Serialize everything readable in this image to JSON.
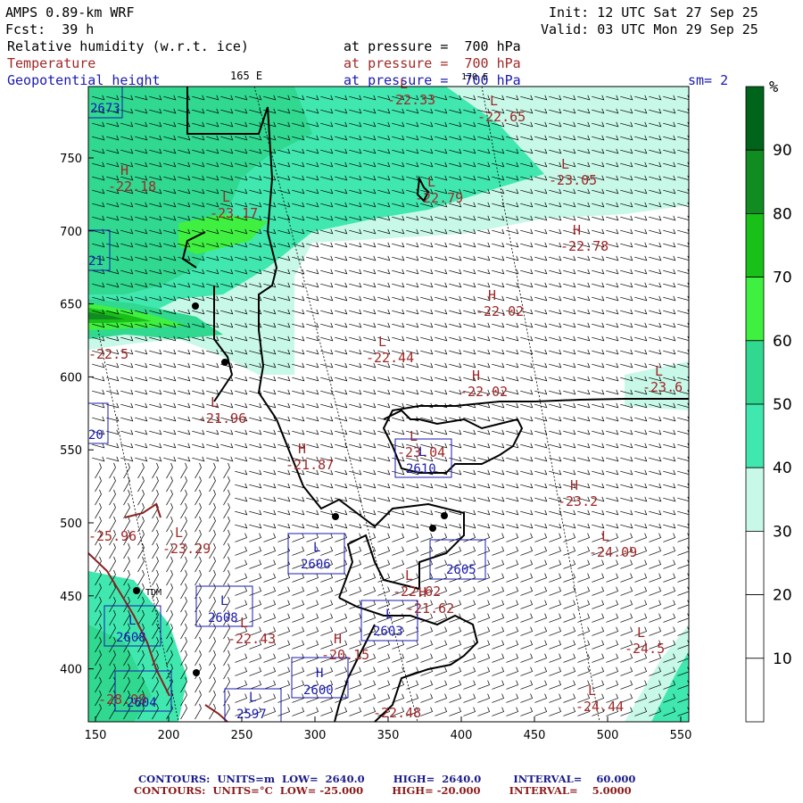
{
  "header": {
    "model": "AMPS 0.89-km WRF",
    "init": "Init: 12 UTC Sat 27 Sep 25",
    "fcst": "Fcst:  39 h",
    "valid": "Valid: 03 UTC Mon 29 Sep 25",
    "field1": "Relative humidity (w.r.t. ice)",
    "field1_level": "at pressure =  700 hPa",
    "field2": "Temperature",
    "field2_level": "at pressure =  700 hPa",
    "field3": "Geopotential height",
    "field3_level": "at pressure =  700 hPa",
    "smoothing": "sm= 2",
    "meridian_left": "165 E",
    "meridian_right": "170 E"
  },
  "colorbar": {
    "unit": "%",
    "labels": [
      "90",
      "80",
      "70",
      "60",
      "50",
      "40",
      "30",
      "20",
      "10"
    ],
    "colors": [
      "#ffffff",
      "#ffffff",
      "#ffffff",
      "#c8f8e8",
      "#40e8b0",
      "#30d890",
      "#40f040",
      "#18c018",
      "#108c20",
      "#00641a"
    ]
  },
  "axes": {
    "x_ticks": [
      "150",
      "200",
      "250",
      "300",
      "350",
      "400",
      "450",
      "500",
      "550"
    ],
    "y_ticks": [
      "750",
      "700",
      "650",
      "600",
      "550",
      "500",
      "450",
      "400"
    ]
  },
  "temperature_labels": [
    {
      "sym": "H",
      "val": "-22.18"
    },
    {
      "sym": "L",
      "val": "-23.17"
    },
    {
      "sym": "L",
      "val": "-22.33"
    },
    {
      "sym": "L",
      "val": "-22.65"
    },
    {
      "sym": "L",
      "val": "-22.79"
    },
    {
      "sym": "L",
      "val": "-23.05"
    },
    {
      "sym": "H",
      "val": "-22.78"
    },
    {
      "sym": "H",
      "val": "-22.02"
    },
    {
      "sym": "L",
      "val": "-22.44"
    },
    {
      "sym": "H",
      "val": "-22.02"
    },
    {
      "sym": "L",
      "val": "-23.6"
    },
    {
      "sym": "L",
      "val": "-21.96"
    },
    {
      "sym": "H",
      "val": "-21.87"
    },
    {
      "sym": "L",
      "val": "-23.04"
    },
    {
      "sym": "H",
      "val": "-23.2"
    },
    {
      "sym": "L",
      "val": "-24.09"
    },
    {
      "sym": "L",
      "val": "-23.29"
    },
    {
      "sym": "L",
      "val": "-22.62"
    },
    {
      "sym": "H",
      "val": "-21.62"
    },
    {
      "sym": "L",
      "val": "-22.43"
    },
    {
      "sym": "H",
      "val": "-20.15"
    },
    {
      "sym": "L",
      "val": "-24.5"
    },
    {
      "sym": "L",
      "val": "-24.44"
    },
    {
      "sym": "",
      "val": "-22.5"
    },
    {
      "sym": "",
      "val": "-22.48"
    },
    {
      "sym": "",
      "val": "-25.96"
    },
    {
      "sym": "",
      "val": "-28.09"
    }
  ],
  "height_labels": [
    {
      "sym": "",
      "val": "2673"
    },
    {
      "sym": "",
      "val": "21"
    },
    {
      "sym": "",
      "val": "20"
    },
    {
      "sym": "L",
      "val": "2610"
    },
    {
      "sym": "L",
      "val": "2606"
    },
    {
      "sym": "",
      "val": "2605"
    },
    {
      "sym": "L",
      "val": "2608"
    },
    {
      "sym": "L",
      "val": "2603"
    },
    {
      "sym": "L",
      "val": "2608"
    },
    {
      "sym": "H",
      "val": "2600"
    },
    {
      "sym": "",
      "val": "2604"
    },
    {
      "sym": "L",
      "val": "2597"
    }
  ],
  "station_label": "TDM",
  "footer": {
    "line1": "CONTOURS:  UNITS=m  LOW=  2640.0        HIGH=  2640.0         INTERVAL=    60.000",
    "line2": "CONTOURS:  UNITS=°C  LOW= -25.000        HIGH= -20.000        INTERVAL=    5.0000"
  }
}
